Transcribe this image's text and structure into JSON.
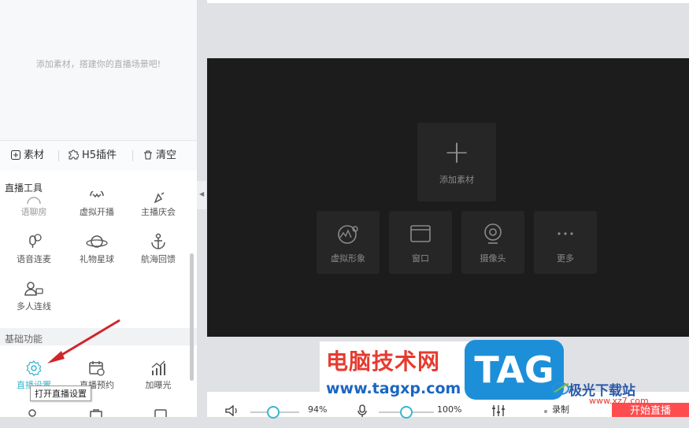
{
  "left_panel": {
    "empty_tip": "添加素材，搭建你的直播场景吧!",
    "toolbar": {
      "material": "素材",
      "h5_plugin": "H5插件",
      "clear": "清空"
    },
    "live_tools_title": "直播工具",
    "live_tools": [
      "语聊房",
      "虚拟开播",
      "主播庆会",
      "语音连麦",
      "礼物星球",
      "航海回馈",
      "多人连线"
    ],
    "basic_title": "基础功能",
    "basic_tools": [
      "直播设置",
      "直播预约",
      "加曝光"
    ]
  },
  "tooltip": "打开直播设置",
  "canvas": {
    "add_material": "添加素材",
    "sources": [
      "虚拟形象",
      "窗口",
      "摄像头",
      "更多"
    ]
  },
  "bottom_bar": {
    "speaker_volume": "94%",
    "speaker_level": 0.47,
    "mic_volume": "100%",
    "mic_level": 0.5,
    "record": "录制",
    "start_live": "开始直播"
  },
  "watermark": {
    "cn_name": "电脑技术网",
    "url": "www.tagxp.com",
    "badge": "TAG",
    "jg_name": "极光下载站",
    "jg_url": "www.xz7.com"
  },
  "colors": {
    "accent": "#37b8cf",
    "start_button": "#ff4d4f",
    "canvas_bg": "#1c1c1c"
  }
}
